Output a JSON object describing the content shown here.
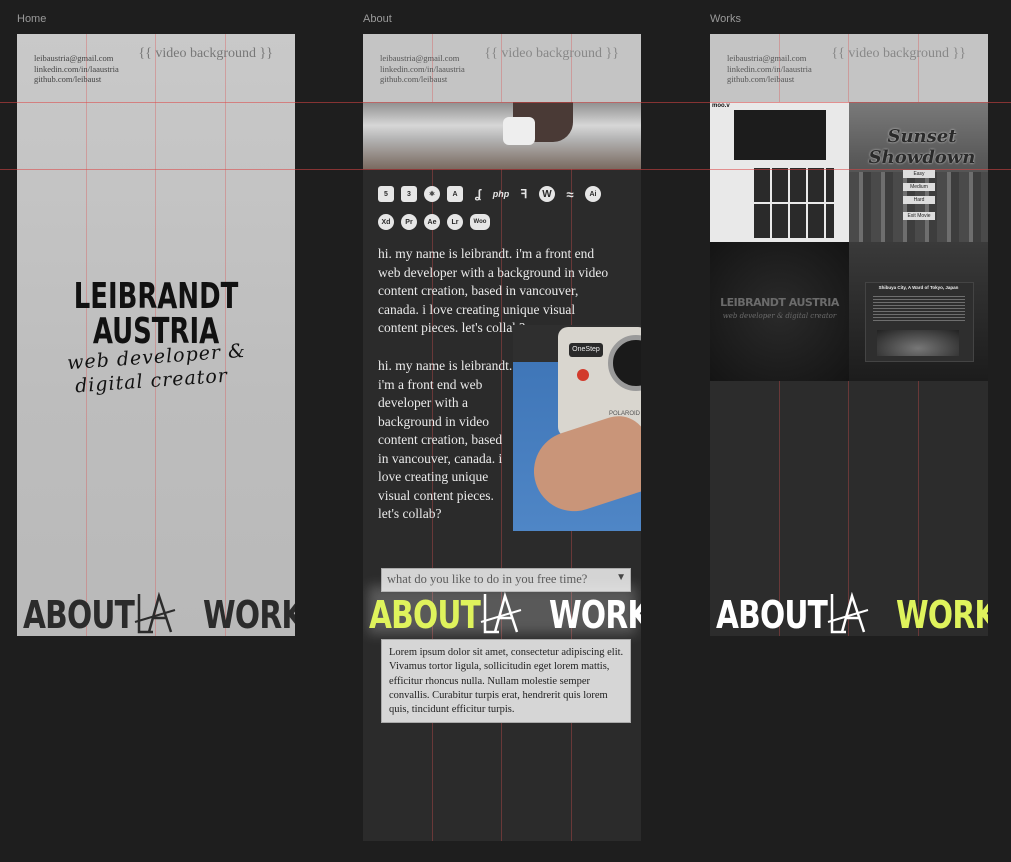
{
  "frames": {
    "home": {
      "label": "Home"
    },
    "about": {
      "label": "About"
    },
    "works": {
      "label": "Works"
    }
  },
  "contact": {
    "email": "leibaustria@gmail.com",
    "linkedin": "linkedin.com/in/laaustria",
    "github": "github.com/leibaust"
  },
  "video_placeholder": "{{ video background }}",
  "hero": {
    "name_line1": "LEIBRANDT",
    "name_line2": "AUSTRIA",
    "tagline_line1": "web developer &",
    "tagline_line2": "digital creator"
  },
  "nav": {
    "about": "ABOUT",
    "logo": "LA",
    "work": "WORK"
  },
  "about": {
    "tech_icons_row1": [
      "html5",
      "css3",
      "react",
      "angular",
      "laravel",
      "php",
      "figma",
      "wordpress",
      "tailwind",
      "Ai"
    ],
    "tech_icons_row2": [
      "Xd",
      "Pr",
      "Ae",
      "Lr",
      "Woo"
    ],
    "bio": "hi. my name is leibrandt. i'm a front end web developer with a background in video content creation, based in vancouver, canada. i love creating unique visual content pieces. let's collab?",
    "bio2_lines": [
      "hi. my name is leibrandt.",
      "i'm a front end web",
      "developer with a",
      "background in video",
      "content creation, based",
      "in vancouver, canada. i",
      "love creating unique",
      "visual content pieces.",
      "let's collab?"
    ],
    "camera_label": "OneStep",
    "camera_brand": "POLAROID",
    "question": "what do you like to do in you free time?",
    "answer": "Lorem ipsum dolor sit amet, consectetur adipiscing elit. Vivamus tortor ligula, sollicitudin eget lorem mattis, efficitur rhoncus nulla. Nullam molestie semper convallis. Curabitur turpis erat, hendrerit quis lorem quis, tincidunt efficitur turpis."
  },
  "works": {
    "project1": {
      "brand": "moo.v",
      "buttons": [
        "Easy",
        "Medium",
        "Hard",
        "Exit Movie"
      ],
      "title": "Sunset Showdown"
    },
    "project2": {
      "title": "LEIBRANDT AUSTRIA",
      "tagline": "web developer & digital creator"
    },
    "project3": {
      "title": "Shibuya City, A Ward of Tokyo, Japan"
    }
  },
  "colors": {
    "accent": "#dff35c",
    "bg": "#1e1e1e",
    "light_frame": "#c2c2c2",
    "dark_frame": "#2a2a2a"
  }
}
